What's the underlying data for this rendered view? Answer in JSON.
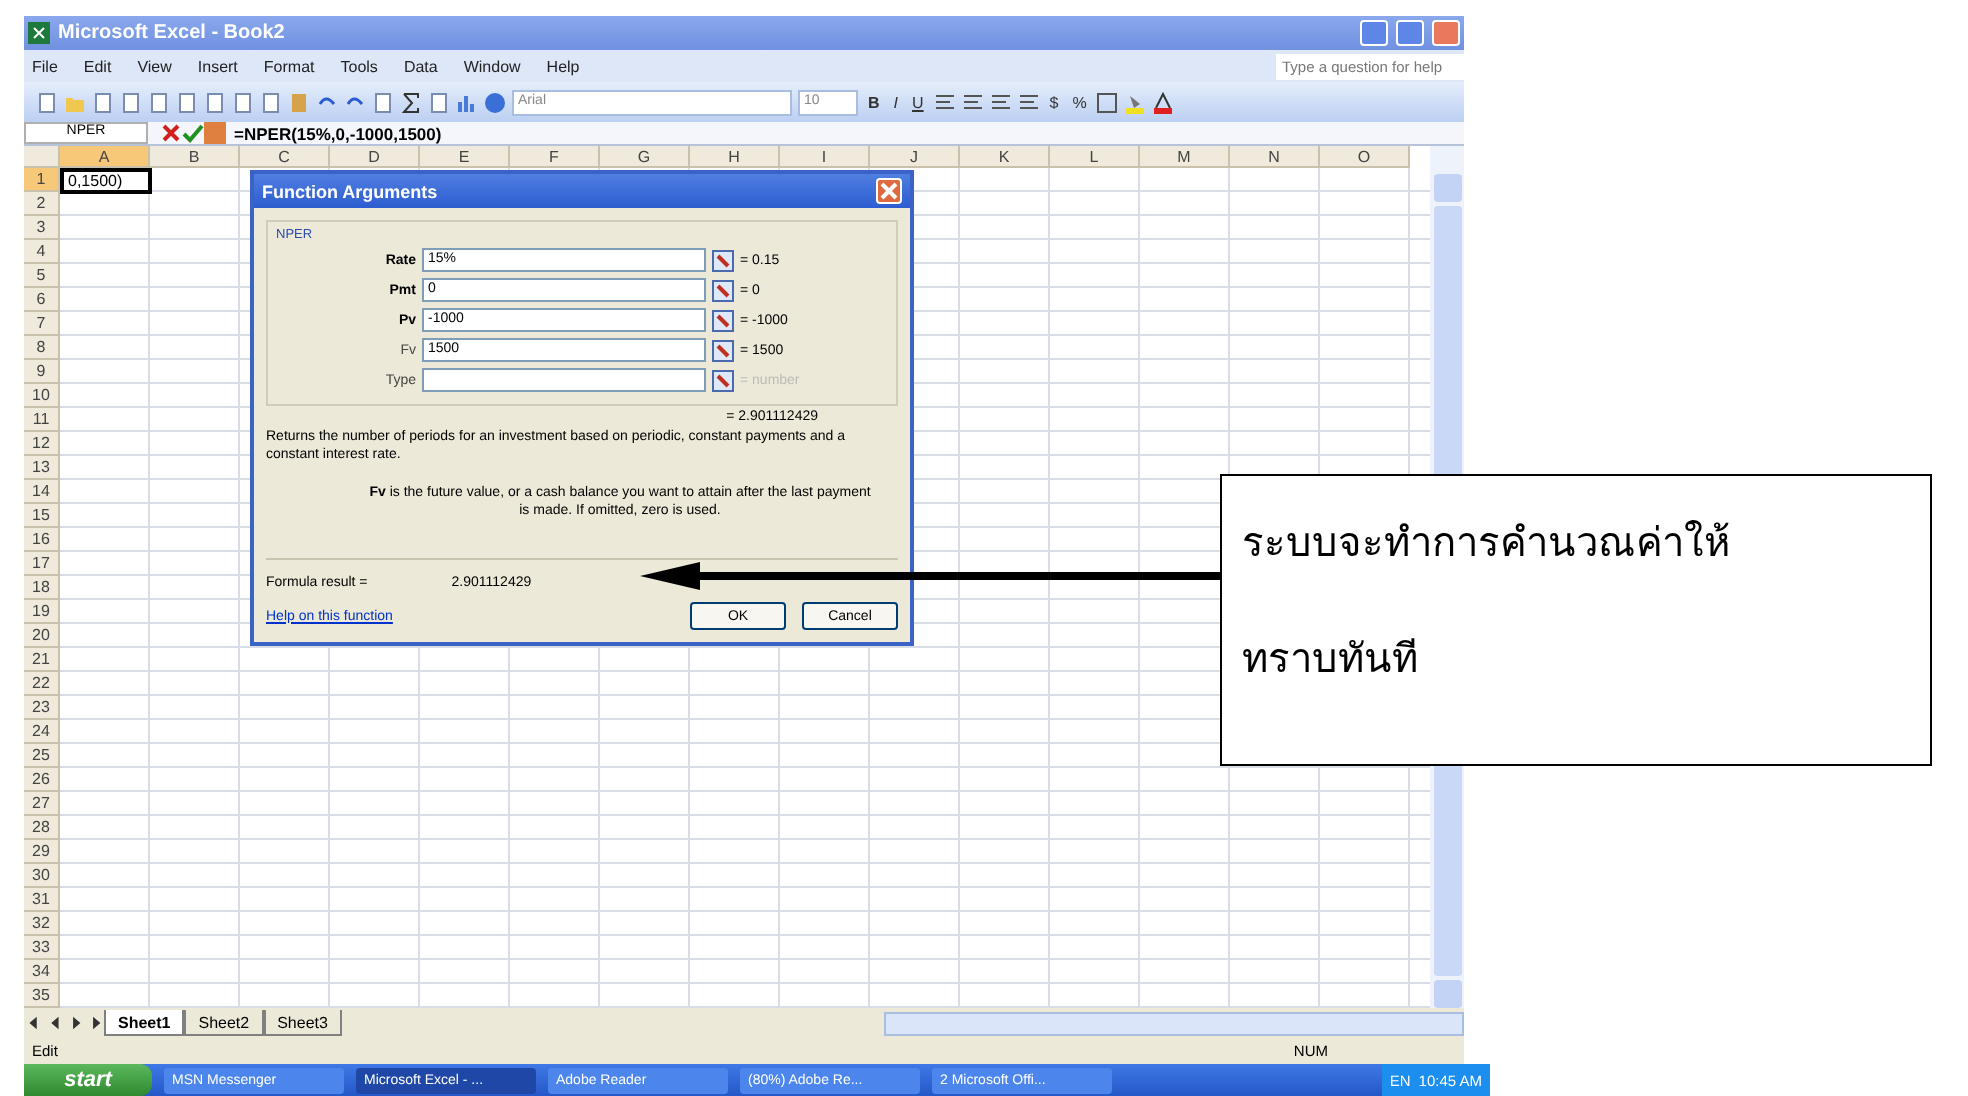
{
  "window": {
    "title": "Microsoft Excel - Book2",
    "help_placeholder": "Type a question for help"
  },
  "menu": [
    "File",
    "Edit",
    "View",
    "Insert",
    "Format",
    "Tools",
    "Data",
    "Window",
    "Help"
  ],
  "format_toolbar": {
    "font": "Arial",
    "size": "10",
    "styles": [
      "B",
      "I",
      "U"
    ],
    "number": [
      "$",
      "%"
    ]
  },
  "formula_bar": {
    "name_box": "NPER",
    "formula": "=NPER(15%,0,-1000,1500)"
  },
  "columns": [
    "A",
    "B",
    "C",
    "D",
    "E",
    "F",
    "G",
    "H",
    "I",
    "J",
    "K",
    "L",
    "M",
    "N",
    "O"
  ],
  "rows": [
    "1",
    "2",
    "3",
    "4",
    "5",
    "6",
    "7",
    "8",
    "9",
    "10",
    "11",
    "12",
    "13",
    "14",
    "15",
    "16",
    "17",
    "18",
    "19",
    "20",
    "21",
    "22",
    "23",
    "24",
    "25",
    "26",
    "27",
    "28",
    "29",
    "30",
    "31",
    "32",
    "33",
    "34",
    "35"
  ],
  "active_cell": {
    "value": "0,1500)"
  },
  "dialog": {
    "title": "Function Arguments",
    "group": "NPER",
    "args": [
      {
        "label": "Rate",
        "required": true,
        "value": "15%",
        "result": "= 0.15"
      },
      {
        "label": "Pmt",
        "required": true,
        "value": "0",
        "result": "= 0"
      },
      {
        "label": "Pv",
        "required": true,
        "value": "-1000",
        "result": "= -1000"
      },
      {
        "label": "Fv",
        "required": false,
        "value": "1500",
        "result": "= 1500"
      },
      {
        "label": "Type",
        "required": false,
        "result": "= number"
      }
    ],
    "total": "= 2.901112429",
    "description": "Returns the number of periods for an investment based on periodic, constant payments and a constant interest rate.",
    "arg_help": "**Fv** is the future value, or a cash balance you want to attain after the last payment is made. If omitted, zero is used.",
    "result_label": "Formula result =",
    "result_value": "2.901112429",
    "help_link": "Help on this function",
    "buttons": [
      "OK",
      "Cancel"
    ]
  },
  "sheets": [
    {
      "label": "Sheet1",
      "selected": true
    },
    {
      "label": "Sheet2",
      "selected": false
    },
    {
      "label": "Sheet3",
      "selected": false
    }
  ],
  "status": {
    "mode": "Edit",
    "num": "NUM"
  },
  "taskbar": {
    "start": "start",
    "items": [
      {
        "label": "MSN Messenger",
        "selected": false
      },
      {
        "label": "Microsoft Excel - ...",
        "selected": true
      },
      {
        "label": "Adobe Reader",
        "selected": false
      },
      {
        "label": "(80%) Adobe Re...",
        "selected": false
      },
      {
        "label": "2 Microsoft Offi...",
        "selected": false
      }
    ],
    "lang": "EN",
    "time": "10:45 AM"
  },
  "callout": {
    "lines": [
      "ระบบจะทำการคำนวณค่าให้",
      "ทราบทันที"
    ]
  }
}
